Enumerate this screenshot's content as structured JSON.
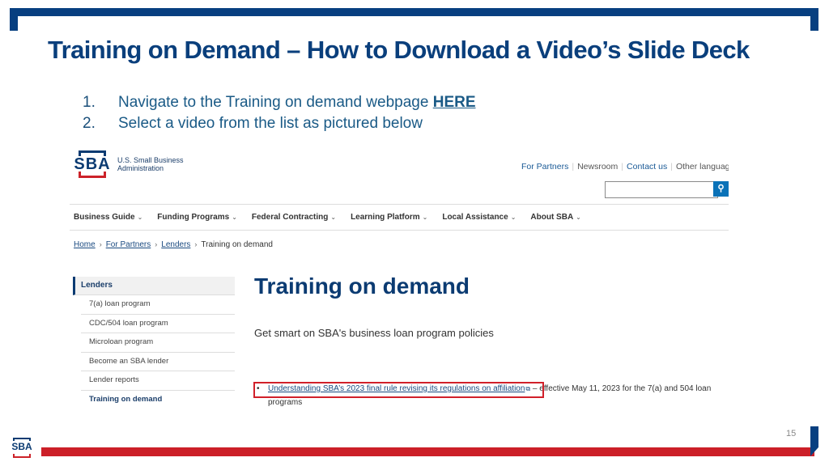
{
  "slide": {
    "title": "Training on Demand – How to Download a Video’s Slide Deck",
    "steps": [
      {
        "num": "1.",
        "text": "Navigate to the Training on demand webpage ",
        "link": "HERE"
      },
      {
        "num": "2.",
        "text": "Select a video from the list as pictured below"
      }
    ],
    "page_number": "15",
    "colors": {
      "primary": "#073f80",
      "accent": "#cc1f28"
    }
  },
  "website": {
    "logo_letters": "SBA",
    "agency_line1": "U.S. Small Business",
    "agency_line2": "Administration",
    "util_links": [
      "For Partners",
      "Newsroom",
      "Contact us",
      "Other languag"
    ],
    "search": {
      "value": "",
      "placeholder": "",
      "button_icon": "search-icon"
    },
    "nav": [
      "Business Guide",
      "Funding Programs",
      "Federal Contracting",
      "Learning Platform",
      "Local Assistance",
      "About SBA"
    ],
    "breadcrumb": [
      "Home",
      "For Partners",
      "Lenders",
      "Training on demand"
    ],
    "sidenav": {
      "heading": "Lenders",
      "items": [
        "7(a) loan program",
        "CDC/504 loan program",
        "Microloan program",
        "Become an SBA lender",
        "Lender reports",
        "Training on demand"
      ]
    },
    "heading": "Training on demand",
    "subheading": "Get smart on SBA's business loan program policies",
    "list": [
      {
        "link": "Understanding SBA’s 2023 final rule revising its regulations on affiliation",
        "ext_icon": "external-link-icon",
        "suffix": " – effective May 11, 2023 for the 7(a) and 504 loan programs"
      }
    ]
  }
}
